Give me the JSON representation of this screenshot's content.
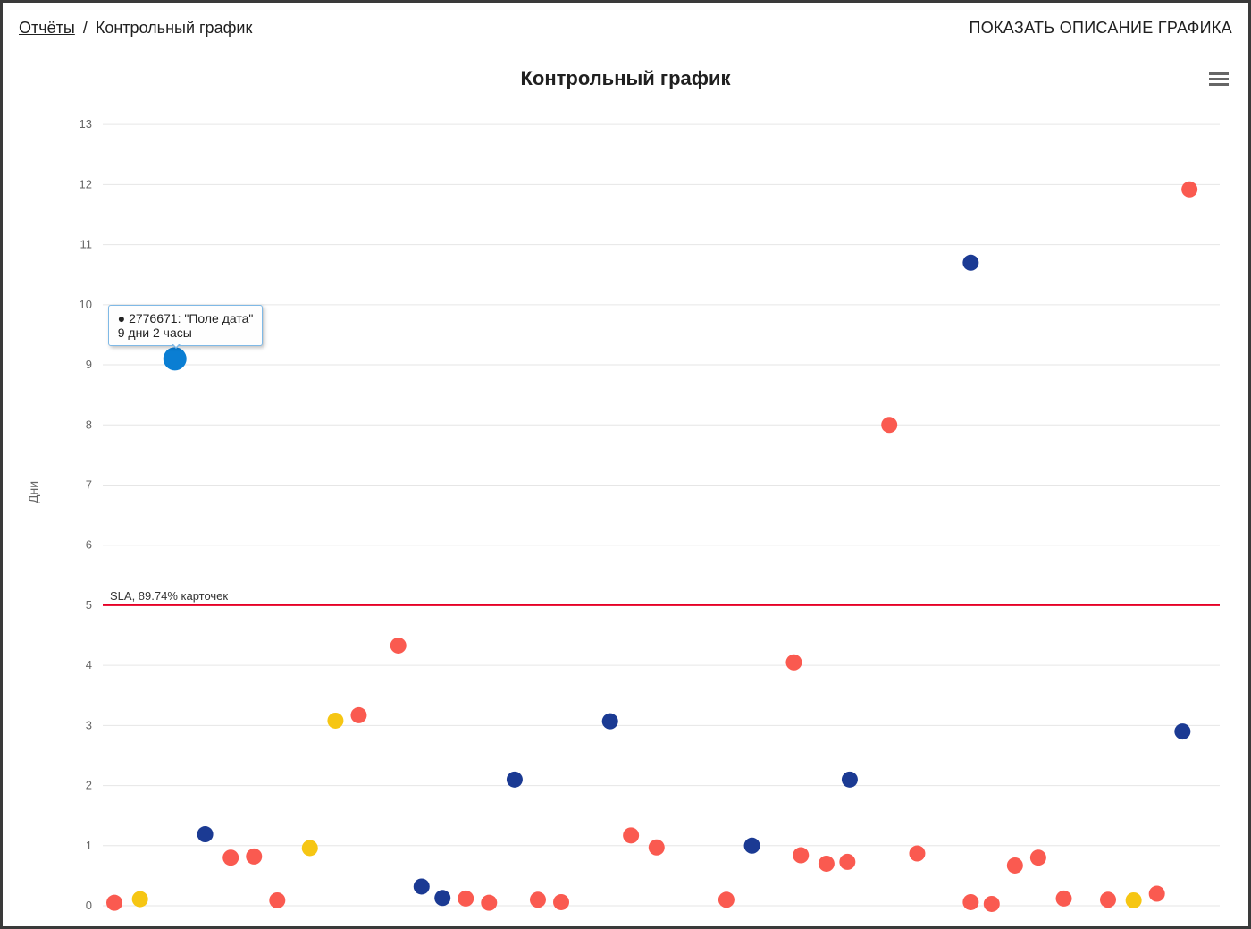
{
  "breadcrumb": {
    "root": "Отчёты",
    "sep": "/",
    "current": "Контрольный график"
  },
  "header": {
    "show_description": "ПОКАЗАТЬ ОПИСАНИЕ ГРАФИКА"
  },
  "colors": {
    "red": "#fa5a50",
    "blue": "#1b3a93",
    "blue_active": "#0a7ed3",
    "yellow": "#f6c613",
    "grid": "#e6e6e6",
    "sla": "#e60026"
  },
  "chart_data": {
    "type": "scatter",
    "title": "Контрольный график",
    "ylabel": "Дни",
    "xlabel": "",
    "y_ticks": [
      0,
      1,
      2,
      3,
      4,
      5,
      6,
      7,
      8,
      9,
      10,
      11,
      12,
      13
    ],
    "ylim": [
      0,
      13.3
    ],
    "xlim": [
      0,
      48
    ],
    "sla": {
      "value": 5,
      "label": "SLA, 89.74% карточек"
    },
    "series": [
      {
        "name": "red",
        "color": "#fa5a50",
        "points": [
          {
            "x": 0.5,
            "y": 0.05
          },
          {
            "x": 5.5,
            "y": 0.8
          },
          {
            "x": 6.5,
            "y": 0.82
          },
          {
            "x": 7.5,
            "y": 0.09
          },
          {
            "x": 11.0,
            "y": 3.17
          },
          {
            "x": 12.7,
            "y": 4.33
          },
          {
            "x": 15.6,
            "y": 0.12
          },
          {
            "x": 16.6,
            "y": 0.05
          },
          {
            "x": 18.7,
            "y": 0.1
          },
          {
            "x": 19.7,
            "y": 0.06
          },
          {
            "x": 22.7,
            "y": 1.17
          },
          {
            "x": 23.8,
            "y": 0.97
          },
          {
            "x": 26.8,
            "y": 0.1
          },
          {
            "x": 29.7,
            "y": 4.05
          },
          {
            "x": 30.0,
            "y": 0.84
          },
          {
            "x": 31.1,
            "y": 0.7
          },
          {
            "x": 32.0,
            "y": 0.73
          },
          {
            "x": 33.8,
            "y": 8.0
          },
          {
            "x": 35.0,
            "y": 0.87
          },
          {
            "x": 37.3,
            "y": 0.06
          },
          {
            "x": 38.2,
            "y": 0.03
          },
          {
            "x": 39.2,
            "y": 0.67
          },
          {
            "x": 40.2,
            "y": 0.8
          },
          {
            "x": 41.3,
            "y": 0.12
          },
          {
            "x": 43.2,
            "y": 0.1
          },
          {
            "x": 45.3,
            "y": 0.2
          },
          {
            "x": 46.7,
            "y": 11.92
          }
        ]
      },
      {
        "name": "yellow",
        "color": "#f6c613",
        "points": [
          {
            "x": 1.6,
            "y": 0.11
          },
          {
            "x": 8.9,
            "y": 0.96
          },
          {
            "x": 10.0,
            "y": 3.08
          },
          {
            "x": 44.3,
            "y": 0.09
          }
        ]
      },
      {
        "name": "blue",
        "color": "#1b3a93",
        "points": [
          {
            "x": 4.4,
            "y": 1.19
          },
          {
            "x": 13.7,
            "y": 0.32
          },
          {
            "x": 14.6,
            "y": 0.13
          },
          {
            "x": 17.7,
            "y": 2.1
          },
          {
            "x": 21.8,
            "y": 3.07
          },
          {
            "x": 27.9,
            "y": 1.0
          },
          {
            "x": 32.1,
            "y": 2.1
          },
          {
            "x": 37.3,
            "y": 10.7
          },
          {
            "x": 46.4,
            "y": 2.9
          }
        ]
      }
    ],
    "active_point": {
      "x": 3.1,
      "y": 9.1,
      "color": "#0a7ed3",
      "radius": 13,
      "tooltip": {
        "line1": "● 2776671: \"Поле дата\"",
        "line2": "9 дни 2 часы"
      }
    }
  }
}
